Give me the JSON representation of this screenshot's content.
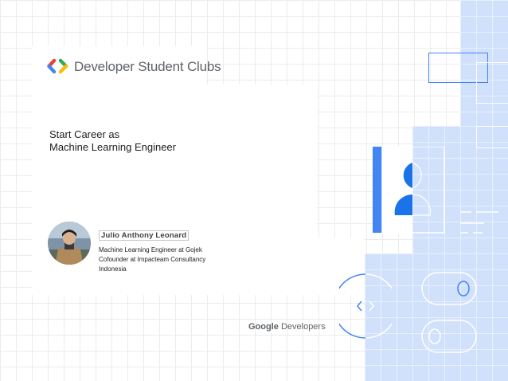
{
  "header": {
    "brand_text": "Developer Student Clubs",
    "logo_colors": [
      "#ea4335",
      "#4285f4",
      "#34a853",
      "#fbbc04"
    ]
  },
  "slide": {
    "title_lines": [
      "Start Career as",
      "Machine Learning Engineer"
    ]
  },
  "speaker": {
    "name": "Julio Anthony Leonard",
    "lines": [
      "Machine Learning Engineer at Gojek",
      "Cofounder at Impacteam Consultancy",
      "Indonesia"
    ]
  },
  "footer": {
    "google_word": "Google",
    "developers_word": "Developers"
  },
  "colors": {
    "accent_blue": "#4285f4",
    "light_blue": "#d2e1fb",
    "outline_blue": "#1a73e8"
  }
}
